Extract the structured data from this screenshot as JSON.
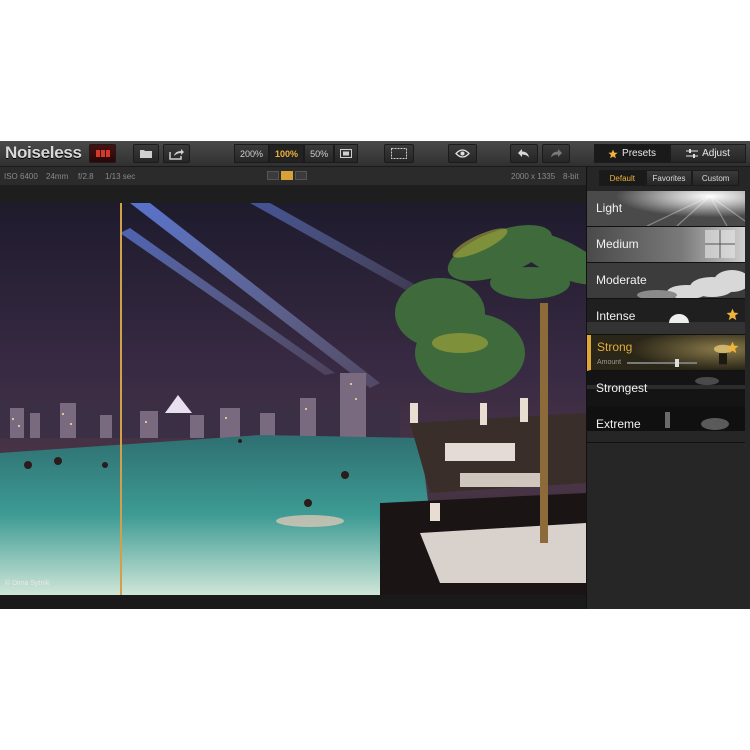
{
  "app": {
    "title": "Noiseless"
  },
  "toolbar": {
    "zoom_options": [
      "200%",
      "100%",
      "50%"
    ],
    "active_zoom": "100%",
    "presets_tab": "Presets",
    "adjust_tab": "Adjust",
    "icons": [
      "batch-icon",
      "open-folder-icon",
      "export-icon",
      "fit-screen-icon",
      "split-view-icon",
      "preview-eye-icon",
      "undo-icon",
      "redo-icon",
      "star-icon",
      "sliders-icon"
    ]
  },
  "info": {
    "iso": "ISO 6400",
    "focal": "24mm",
    "aperture": "f/2.8",
    "shutter": "1/13 sec",
    "dimensions": "2000 x 1335",
    "bitdepth": "8-bit"
  },
  "panel": {
    "subtabs": [
      "Default",
      "Favorites",
      "Custom"
    ],
    "active_subtab": "Default",
    "presets": [
      {
        "label": "Light",
        "favorite": false
      },
      {
        "label": "Medium",
        "favorite": false
      },
      {
        "label": "Moderate",
        "favorite": false
      },
      {
        "label": "Intense",
        "favorite": true
      },
      {
        "label": "Strong",
        "favorite": true
      },
      {
        "label": "Strongest",
        "favorite": false
      },
      {
        "label": "Extreme",
        "favorite": false
      }
    ],
    "active_preset": "Strong",
    "amount_label": "Amount",
    "amount_value": 0.72
  },
  "preview": {
    "credit": "© Dima Sytnik"
  },
  "colors": {
    "accent": "#e0a838",
    "background": "#1e1e1e",
    "panel": "#262626"
  }
}
